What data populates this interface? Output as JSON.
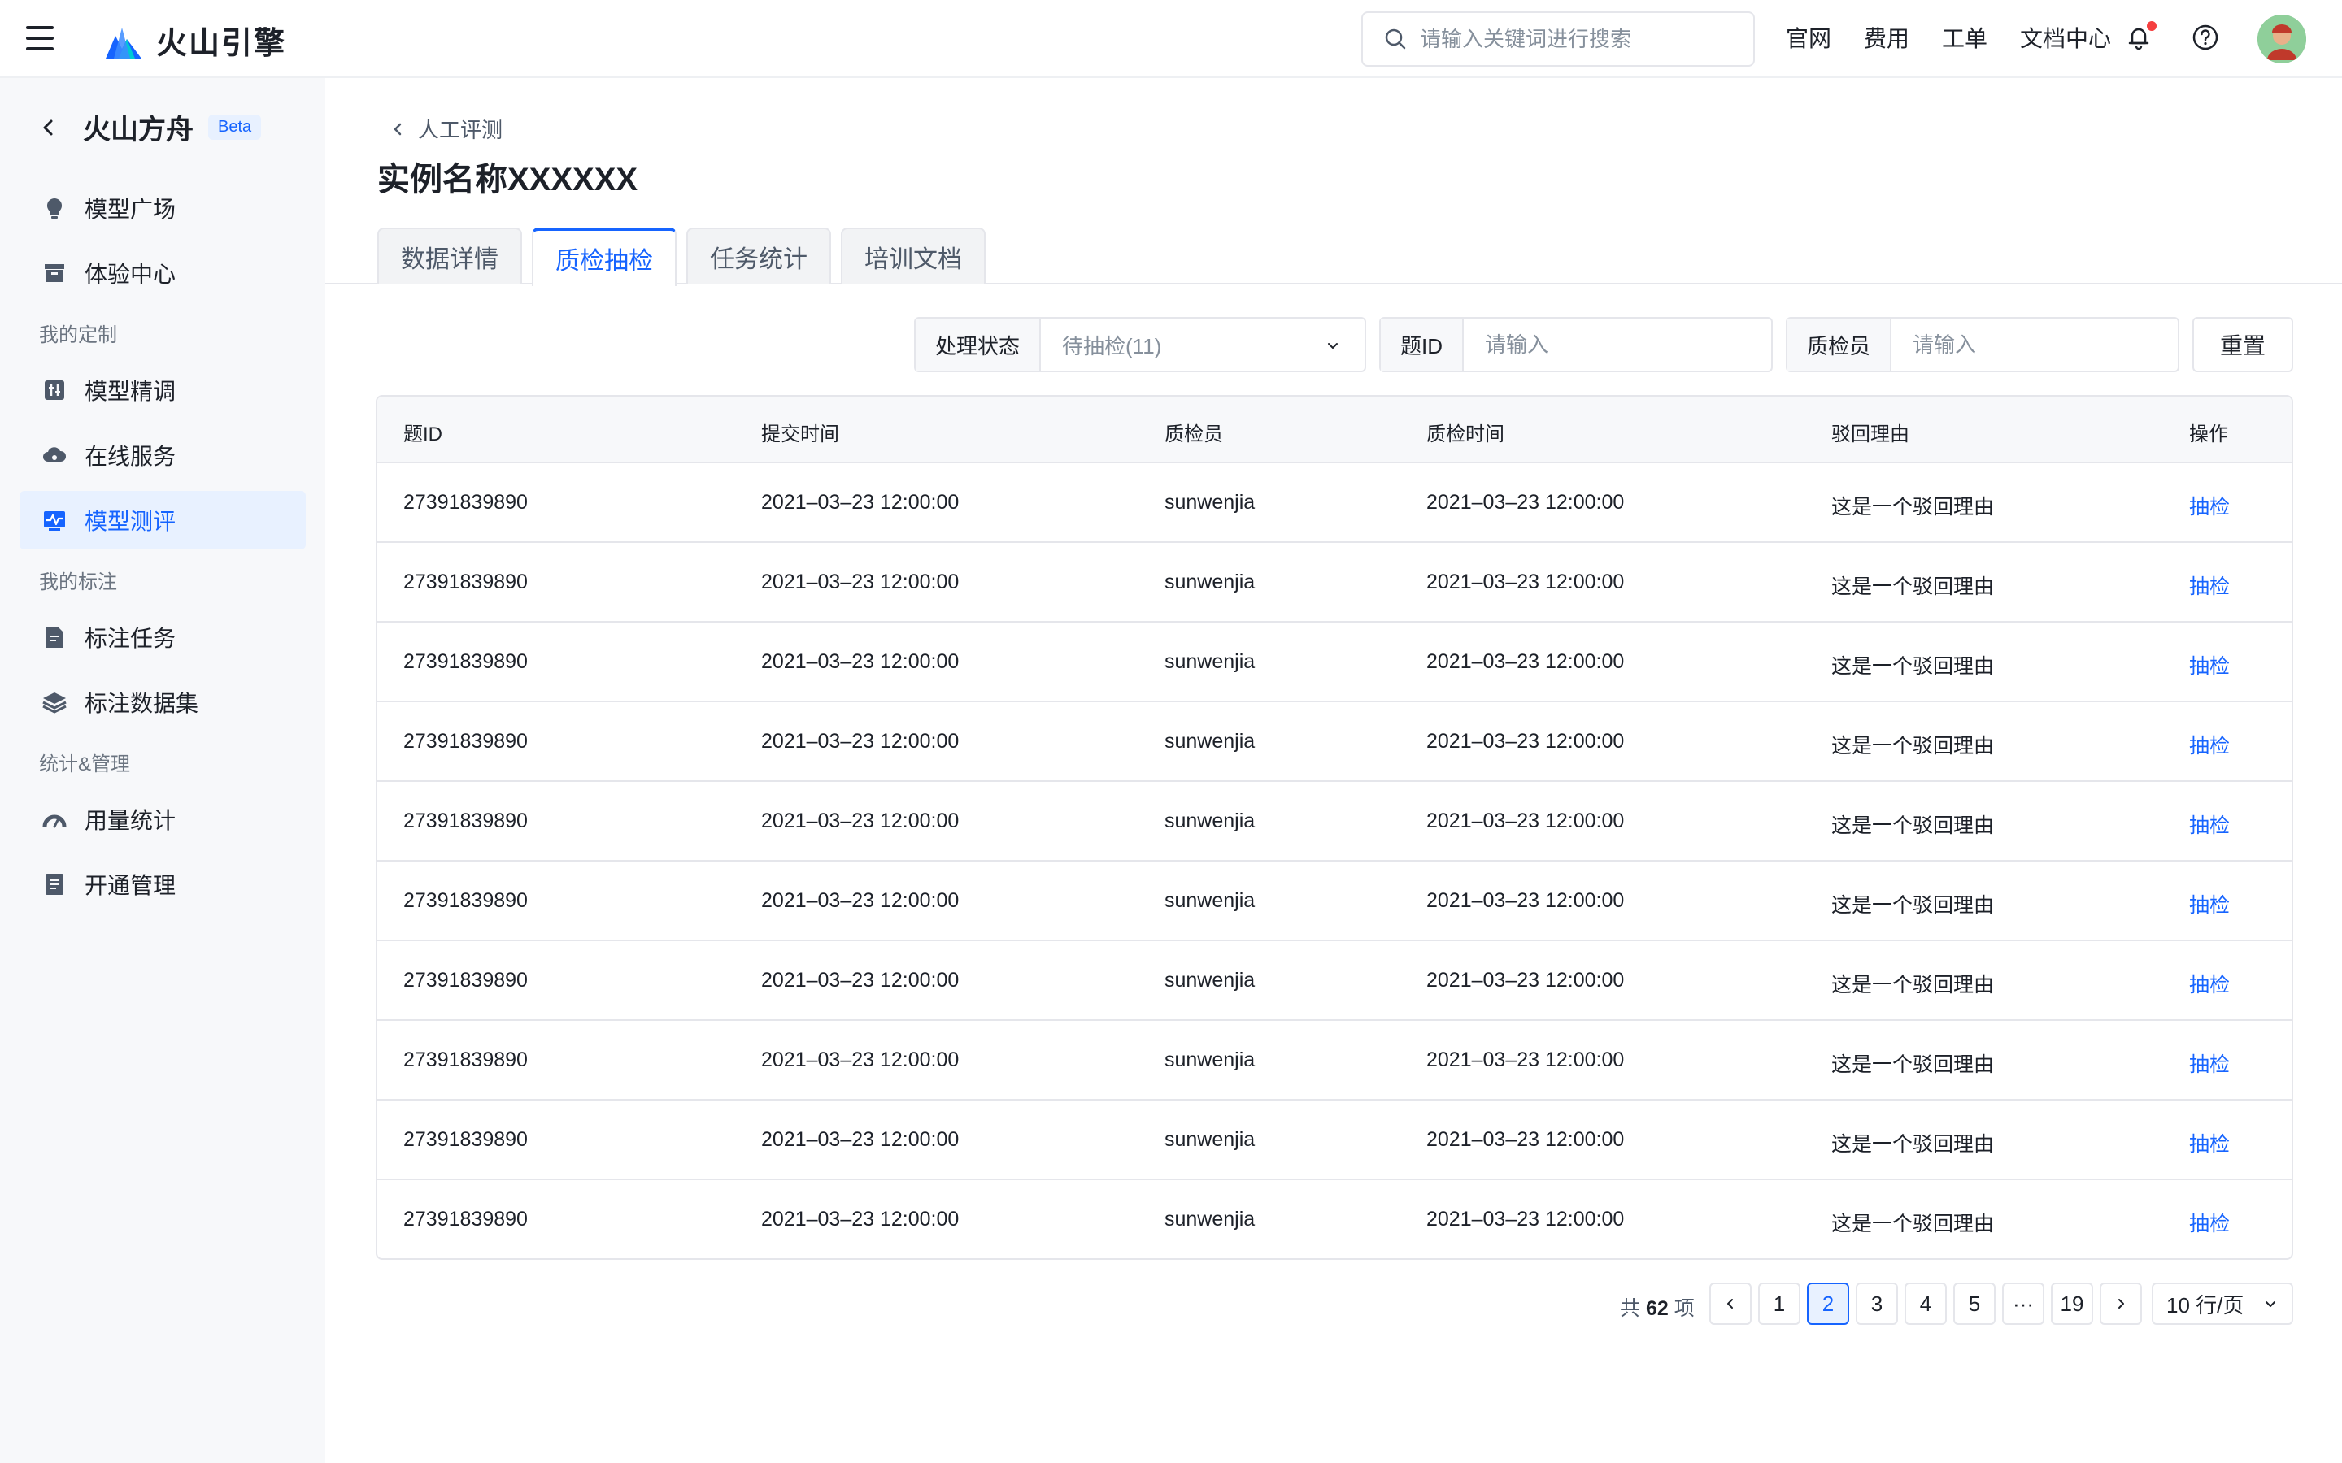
{
  "header": {
    "brand": "火山引擎",
    "search_placeholder": "请输入关键词进行搜索",
    "links": [
      "官网",
      "费用",
      "工单",
      "文档中心"
    ]
  },
  "sidebar": {
    "title": "火山方舟",
    "badge": "Beta",
    "items": [
      {
        "label": "模型广场",
        "icon": "bulb-icon"
      },
      {
        "label": "体验中心",
        "icon": "archive-icon"
      },
      {
        "label": "模型精调",
        "icon": "tune-icon"
      },
      {
        "label": "在线服务",
        "icon": "cloud-icon"
      },
      {
        "label": "模型测评",
        "icon": "chart-icon",
        "active": true
      },
      {
        "label": "标注任务",
        "icon": "doc-icon"
      },
      {
        "label": "标注数据集",
        "icon": "layers-icon"
      },
      {
        "label": "用量统计",
        "icon": "gauge-icon"
      },
      {
        "label": "开通管理",
        "icon": "list-icon"
      }
    ],
    "groups": [
      "我的定制",
      "我的标注",
      "统计&管理"
    ]
  },
  "breadcrumb": "人工评测",
  "page_title": "实例名称XXXXXX",
  "tabs": [
    "数据详情",
    "质检抽检",
    "任务统计",
    "培训文档"
  ],
  "active_tab": "质检抽检",
  "filters": {
    "status_label": "处理状态",
    "status_value": "待抽检(11)",
    "id_label": "题ID",
    "id_placeholder": "请输入",
    "inspector_label": "质检员",
    "inspector_placeholder": "请输入",
    "reset": "重置"
  },
  "table": {
    "columns": [
      "题ID",
      "提交时间",
      "质检员",
      "质检时间",
      "驳回理由",
      "操作"
    ],
    "rows": [
      [
        "27391839890",
        "2021–03–23 12:00:00",
        "sunwenjia",
        "2021–03–23 12:00:00",
        "这是一个驳回理由",
        "抽检"
      ],
      [
        "27391839890",
        "2021–03–23 12:00:00",
        "sunwenjia",
        "2021–03–23 12:00:00",
        "这是一个驳回理由",
        "抽检"
      ],
      [
        "27391839890",
        "2021–03–23 12:00:00",
        "sunwenjia",
        "2021–03–23 12:00:00",
        "这是一个驳回理由",
        "抽检"
      ],
      [
        "27391839890",
        "2021–03–23 12:00:00",
        "sunwenjia",
        "2021–03–23 12:00:00",
        "这是一个驳回理由",
        "抽检"
      ],
      [
        "27391839890",
        "2021–03–23 12:00:00",
        "sunwenjia",
        "2021–03–23 12:00:00",
        "这是一个驳回理由",
        "抽检"
      ],
      [
        "27391839890",
        "2021–03–23 12:00:00",
        "sunwenjia",
        "2021–03–23 12:00:00",
        "这是一个驳回理由",
        "抽检"
      ],
      [
        "27391839890",
        "2021–03–23 12:00:00",
        "sunwenjia",
        "2021–03–23 12:00:00",
        "这是一个驳回理由",
        "抽检"
      ],
      [
        "27391839890",
        "2021–03–23 12:00:00",
        "sunwenjia",
        "2021–03–23 12:00:00",
        "这是一个驳回理由",
        "抽检"
      ],
      [
        "27391839890",
        "2021–03–23 12:00:00",
        "sunwenjia",
        "2021–03–23 12:00:00",
        "这是一个驳回理由",
        "抽检"
      ],
      [
        "27391839890",
        "2021–03–23 12:00:00",
        "sunwenjia",
        "2021–03–23 12:00:00",
        "这是一个驳回理由",
        "抽检"
      ]
    ]
  },
  "pagination": {
    "total_prefix": "共",
    "total": "62",
    "total_suffix": "项",
    "pages": [
      "1",
      "2",
      "3",
      "4",
      "5",
      "···",
      "19"
    ],
    "current": "2",
    "page_size": "10 行/页"
  },
  "colors": {
    "accent": "#1664ff",
    "sidebar_bg": "#f7f8fa",
    "active_bg": "#e8f1ff",
    "notification_dot": "#f53f3f"
  }
}
